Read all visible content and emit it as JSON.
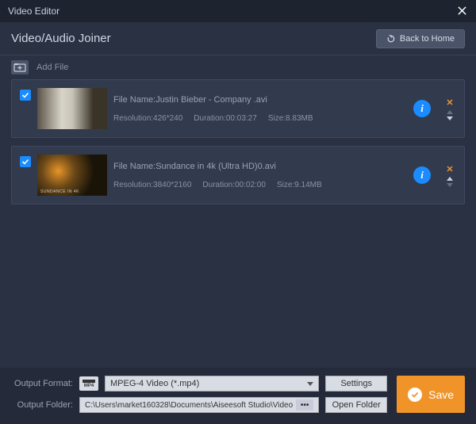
{
  "titlebar": {
    "title": "Video Editor"
  },
  "header": {
    "title": "Video/Audio Joiner",
    "back_label": "Back to Home"
  },
  "addfile": {
    "label": "Add File"
  },
  "files": [
    {
      "checked": true,
      "name_label": "File Name:",
      "name": "Justin Bieber - Company .avi",
      "res_label": "Resolution:",
      "resolution": "426*240",
      "dur_label": "Duration:",
      "duration": "00:03:27",
      "size_label": "Size:",
      "size": "8.83MB"
    },
    {
      "checked": true,
      "name_label": "File Name:",
      "name": "Sundance in 4k (Ultra HD)0.avi",
      "res_label": "Resolution:",
      "resolution": "3840*2160",
      "dur_label": "Duration:",
      "duration": "00:02:00",
      "size_label": "Size:",
      "size": "9.14MB"
    }
  ],
  "output": {
    "format_label": "Output Format:",
    "format_value": "MPEG-4 Video (*.mp4)",
    "settings_label": "Settings",
    "folder_label": "Output Folder:",
    "folder_value": "C:\\Users\\market160328\\Documents\\Aiseesoft Studio\\Video",
    "open_folder_label": "Open Folder",
    "save_label": "Save"
  }
}
